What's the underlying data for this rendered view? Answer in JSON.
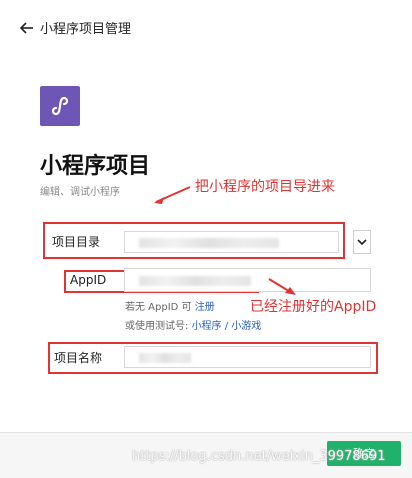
{
  "header": {
    "title": "小程序项目管理"
  },
  "page": {
    "heading": "小程序项目",
    "subheading": "编辑、调试小程序"
  },
  "form": {
    "project_dir_label": "项目目录",
    "appid_label": "AppID",
    "appid_hint_prefix": "若无 AppID 可",
    "appid_hint_register": "注册",
    "testid_hint_prefix": "或使用测试号:",
    "testid_miniprogram": "小程序",
    "testid_sep": "/",
    "testid_game": "小游戏",
    "project_name_label": "项目名称"
  },
  "annotations": {
    "import_note": "把小程序的项目导进来",
    "appid_note": "已经注册好的AppID"
  },
  "footer": {
    "confirm_label": "确定"
  },
  "watermark": "https://blog.csdn.net/weixin_39978691",
  "colors": {
    "accent": "#20b26a",
    "logo": "#6e56b6",
    "annotation": "#e23333",
    "link": "#2860c4"
  }
}
